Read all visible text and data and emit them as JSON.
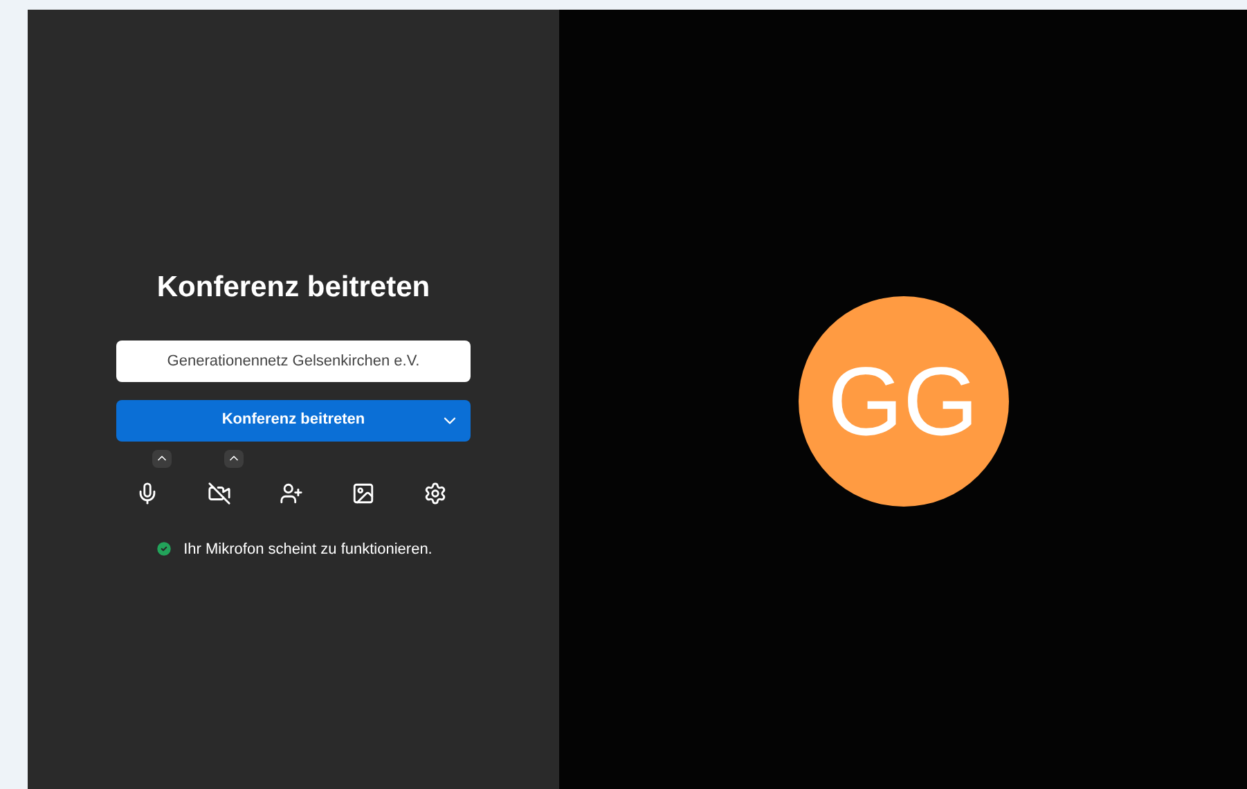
{
  "title": "Konferenz beitreten",
  "name_field": {
    "value": "Generationennetz Gelsenkirchen e.V."
  },
  "join_button": {
    "label": "Konferenz beitreten"
  },
  "toolbar": [
    {
      "kind": "microphone",
      "has_menu": true
    },
    {
      "kind": "camera-off",
      "has_menu": true
    },
    {
      "kind": "invite",
      "has_menu": false
    },
    {
      "kind": "background",
      "has_menu": false
    },
    {
      "kind": "settings",
      "has_menu": false
    }
  ],
  "status": {
    "ok": true,
    "text": "Ihr Mikrofon scheint zu funktionieren."
  },
  "avatar": {
    "initials": "GG",
    "color": "#ff9b42"
  }
}
